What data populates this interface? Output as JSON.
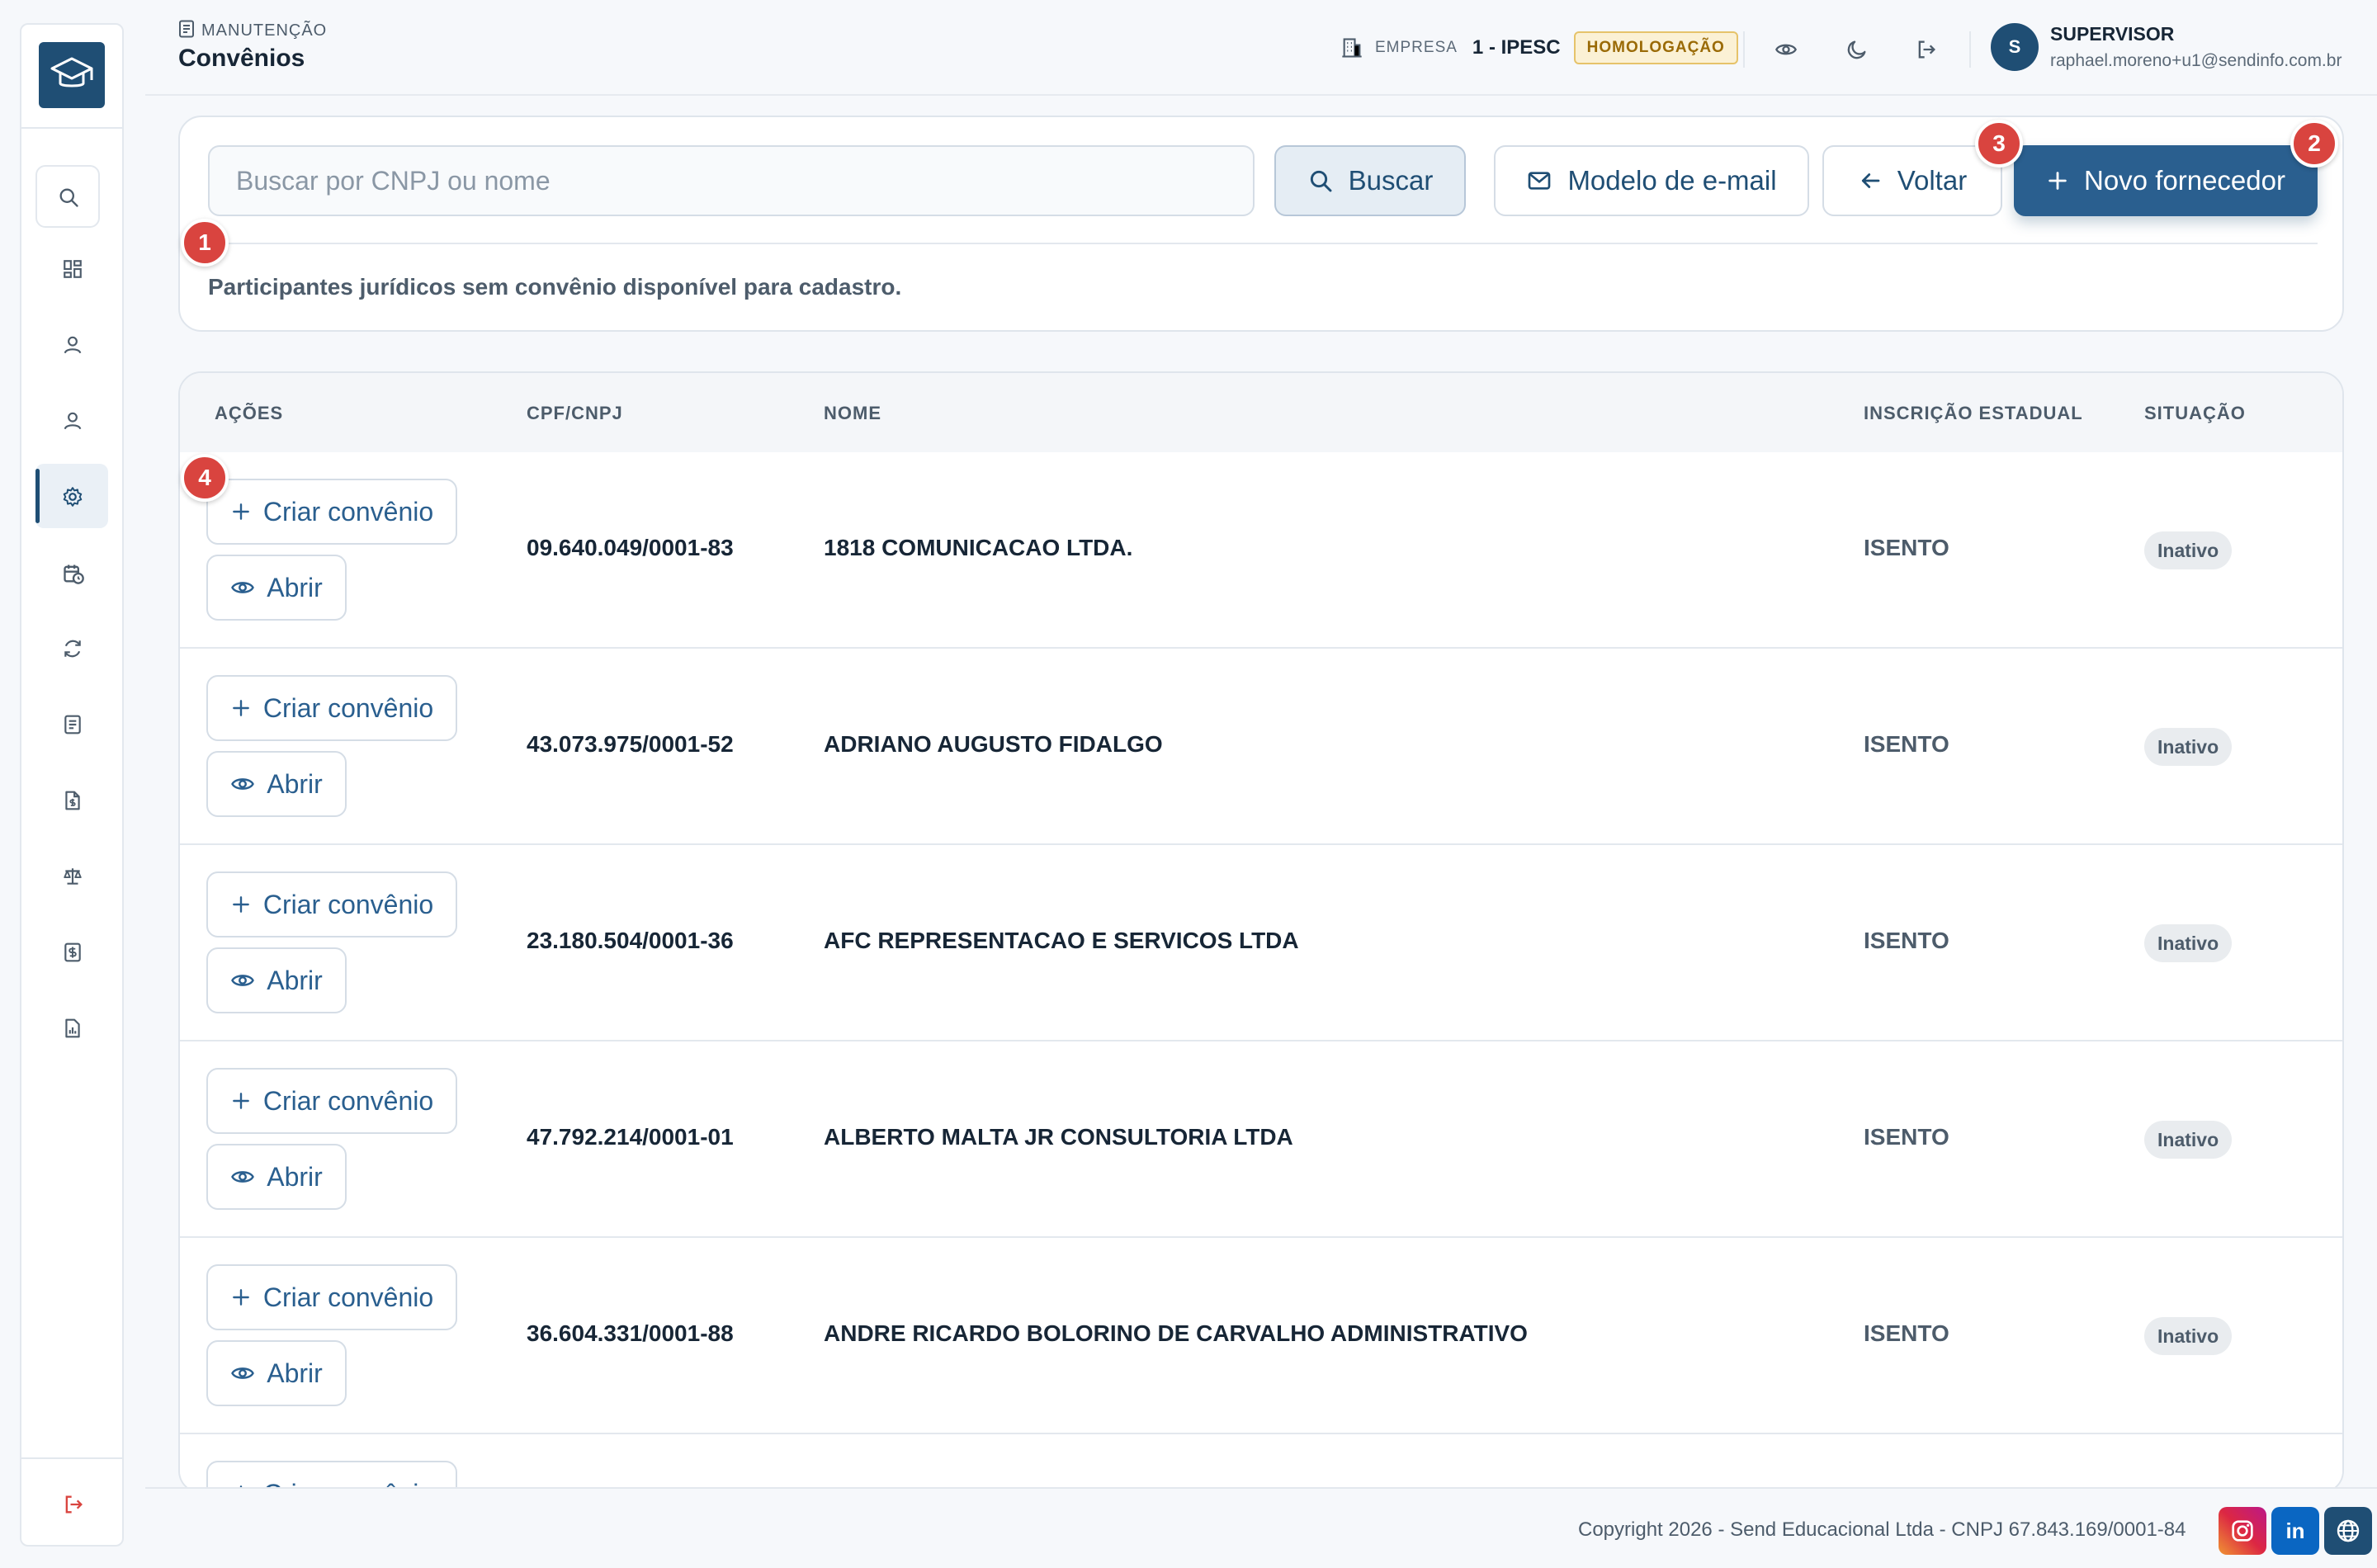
{
  "header": {
    "breadcrumb": "MANUTENÇÃO",
    "title": "Convênios",
    "company_label": "EMPRESA",
    "company_value": "1 - IPESC",
    "env_badge": "HOMOLOGAÇÃO",
    "user_initial": "S",
    "user_name": "SUPERVISOR",
    "user_email": "raphael.moreno+u1@sendinfo.com.br"
  },
  "sidebar": {
    "items": [
      {
        "icon": "dashboard-icon"
      },
      {
        "icon": "user-icon"
      },
      {
        "icon": "user-icon"
      },
      {
        "icon": "gear-icon",
        "active": true
      },
      {
        "icon": "calendar-clock-icon"
      },
      {
        "icon": "refresh-icon"
      },
      {
        "icon": "document-icon"
      },
      {
        "icon": "file-dollar-icon"
      },
      {
        "icon": "scale-icon"
      },
      {
        "icon": "dollar-doc-icon"
      },
      {
        "icon": "report-chart-icon"
      }
    ],
    "logout_icon": "logout-icon"
  },
  "search": {
    "placeholder": "Buscar por CNPJ ou nome",
    "buscar_label": "Buscar",
    "modelo_label": "Modelo de e-mail",
    "voltar_label": "Voltar",
    "novo_label": "Novo fornecedor",
    "info": "Participantes jurídicos sem convênio disponível para cadastro."
  },
  "markers": [
    "1",
    "2",
    "3",
    "4"
  ],
  "table": {
    "headers": [
      "AÇÕES",
      "CPF/CNPJ",
      "NOME",
      "INSCRIÇÃO ESTADUAL",
      "SITUAÇÃO"
    ],
    "criar_label": "Criar convênio",
    "abrir_label": "Abrir",
    "rows": [
      {
        "cnpj": "09.640.049/0001-83",
        "nome": "1818 COMUNICACAO LTDA.",
        "ie": "ISENTO",
        "situacao": "Inativo"
      },
      {
        "cnpj": "43.073.975/0001-52",
        "nome": "ADRIANO AUGUSTO FIDALGO",
        "ie": "ISENTO",
        "situacao": "Inativo"
      },
      {
        "cnpj": "23.180.504/0001-36",
        "nome": "AFC REPRESENTACAO E SERVICOS LTDA",
        "ie": "ISENTO",
        "situacao": "Inativo"
      },
      {
        "cnpj": "47.792.214/0001-01",
        "nome": "ALBERTO MALTA JR CONSULTORIA LTDA",
        "ie": "ISENTO",
        "situacao": "Inativo"
      },
      {
        "cnpj": "36.604.331/0001-88",
        "nome": "ANDRE RICARDO BOLORINO DE CARVALHO ADMINISTRATIVO",
        "ie": "ISENTO",
        "situacao": "Inativo"
      }
    ],
    "partial_row_label": "Criar convênio"
  },
  "footer": {
    "copyright": "Copyright 2026 - Send Educacional Ltda - CNPJ 67.843.169/0001-84",
    "linkedin_label": "in"
  },
  "colors": {
    "brand": "#1f4e74",
    "primary_button": "#2a5f8f",
    "marker": "#d9443f",
    "badge_bg": "#fbf1d5",
    "instagram": "#c13584",
    "linkedin": "#0a66c2"
  }
}
